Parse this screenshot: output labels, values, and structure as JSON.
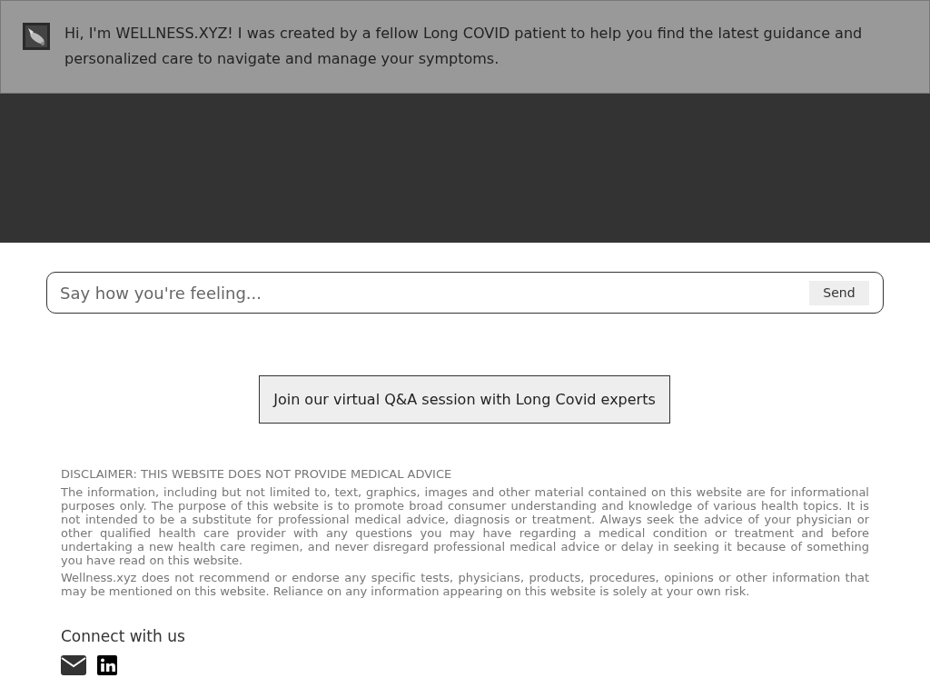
{
  "chat": {
    "message": "Hi, I'm WELLNESS.XYZ! I was created by a fellow Long COVID patient to help you find the latest guidance and personalized care to navigate and manage your symptoms."
  },
  "input": {
    "placeholder": "Say how you're feeling...",
    "send": "Send"
  },
  "qa_button": "Join our virtual Q&A session with Long Covid experts",
  "disclaimer": {
    "heading": "DISCLAIMER: THIS WEBSITE DOES NOT PROVIDE MEDICAL ADVICE",
    "paragraphs": [
      "The information, including but not limited to, text, graphics, images and other material contained on this website are for informational purposes only. The purpose of this website is to promote broad consumer understanding and knowledge of various health topics. It is not intended to be a substitute for professional medical advice, diagnosis or treatment. Always seek the advice of your physician or other qualified health care provider with any questions you may have regarding a medical condition or treatment and before undertaking a new health care regimen, and never disregard professional medical advice or delay in seeking it because of something you have read on this website.",
      "Wellness.xyz does not recommend or endorse any specific tests, physicians, products, procedures, opinions or other information that may be mentioned on this website. Reliance on any information appearing on this website is solely at your own risk."
    ]
  },
  "connect": {
    "heading": "Connect with us"
  }
}
